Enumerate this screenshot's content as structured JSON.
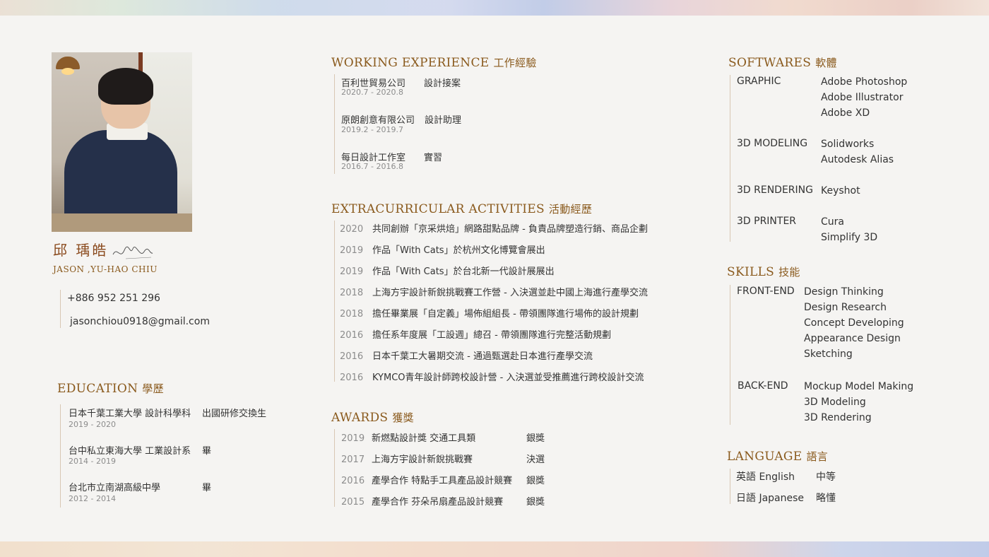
{
  "profile": {
    "name_cn": "邱 瑀皓",
    "name_en": "JASON ,YU-HAO CHIU",
    "phone": "+886 952 251 296",
    "email": "jasonchiou0918@gmail.com"
  },
  "education": {
    "title": "EDUCATION",
    "title_cn": "學歷",
    "items": [
      {
        "school": "日本千葉工業大學 設計科學科",
        "note": "出國研修交換生",
        "years": "2019 - 2020"
      },
      {
        "school": "台中私立東海大學 工業設計系",
        "note": "畢",
        "years": "2014 - 2019"
      },
      {
        "school": "台北市立南湖高級中學",
        "note": "畢",
        "years": "2012 - 2014"
      }
    ]
  },
  "work": {
    "title": "WORKING EXPERIENCE",
    "title_cn": "工作經驗",
    "items": [
      {
        "company": "百利世貿易公司",
        "role": "設計接案",
        "period": "2020.7 - 2020.8"
      },
      {
        "company": "原朗創意有限公司",
        "role": "設計助理",
        "period": "2019.2 - 2019.7"
      },
      {
        "company": "每日設計工作室",
        "role": "實習",
        "period": "2016.7 - 2016.8"
      }
    ]
  },
  "activities": {
    "title": "EXTRACURRICULAR ACTIVITIES",
    "title_cn": "活動經歷",
    "items": [
      {
        "year": "2020",
        "text": "共同創辦「京采烘焙」網路甜點品牌 - 負責品牌塑造行銷、商品企劃"
      },
      {
        "year": "2019",
        "text": "作品「With Cats」於杭州文化博覽會展出"
      },
      {
        "year": "2019",
        "text": "作品「With Cats」於台北新一代設計展展出"
      },
      {
        "year": "2018",
        "text": "上海方宇設計新銳挑戰賽工作營 - 入決選並赴中國上海進行產學交流"
      },
      {
        "year": "2018",
        "text": "擔任畢業展「自定義」場佈組組長 - 帶領團隊進行場佈的設計規劃"
      },
      {
        "year": "2016",
        "text": "擔任系年度展「工設週」總召 - 帶領團隊進行完整活動規劃"
      },
      {
        "year": "2016",
        "text": "日本千葉工大暑期交流 - 通過甄選赴日本進行產學交流"
      },
      {
        "year": "2016",
        "text": "KYMCO青年設計師跨校設計營 - 入決選並受推薦進行跨校設計交流"
      }
    ]
  },
  "awards": {
    "title": "AWARDS",
    "title_cn": "獲獎",
    "items": [
      {
        "year": "2019",
        "name": "新燃點設計獎 交通工具類",
        "result": "銀獎"
      },
      {
        "year": "2017",
        "name": "上海方宇設計新銳挑戰賽",
        "result": "決選"
      },
      {
        "year": "2016",
        "name": "產學合作 特點手工具產品設計競賽",
        "result": "銀獎"
      },
      {
        "year": "2015",
        "name": "產學合作 芬朵吊扇產品設計競賽",
        "result": "銀獎"
      }
    ]
  },
  "softwares": {
    "title": "SOFTWARES",
    "title_cn": "軟體",
    "groups": [
      {
        "category": "GRAPHIC",
        "tools": [
          "Adobe Photoshop",
          "Adobe Illustrator",
          "Adobe XD"
        ]
      },
      {
        "category": "3D MODELING",
        "tools": [
          "Solidworks",
          "Autodesk Alias"
        ]
      },
      {
        "category": "3D RENDERING",
        "tools": [
          "Keyshot"
        ]
      },
      {
        "category": "3D PRINTER",
        "tools": [
          "Cura",
          "Simplify 3D"
        ]
      }
    ]
  },
  "skills": {
    "title": "SKILLS",
    "title_cn": "技能",
    "groups": [
      {
        "category": "FRONT-END",
        "items": [
          "Design Thinking",
          "Design Research",
          "Concept Developing",
          "Appearance Design",
          "Sketching"
        ]
      },
      {
        "category": "BACK-END",
        "items": [
          "Mockup Model Making",
          "3D Modeling",
          "3D Rendering"
        ]
      }
    ]
  },
  "language": {
    "title": "LANGUAGE",
    "title_cn": "語言",
    "items": [
      {
        "language": "英語 English",
        "level": "中等"
      },
      {
        "language": "日語 Japanese",
        "level": "略懂"
      }
    ]
  }
}
